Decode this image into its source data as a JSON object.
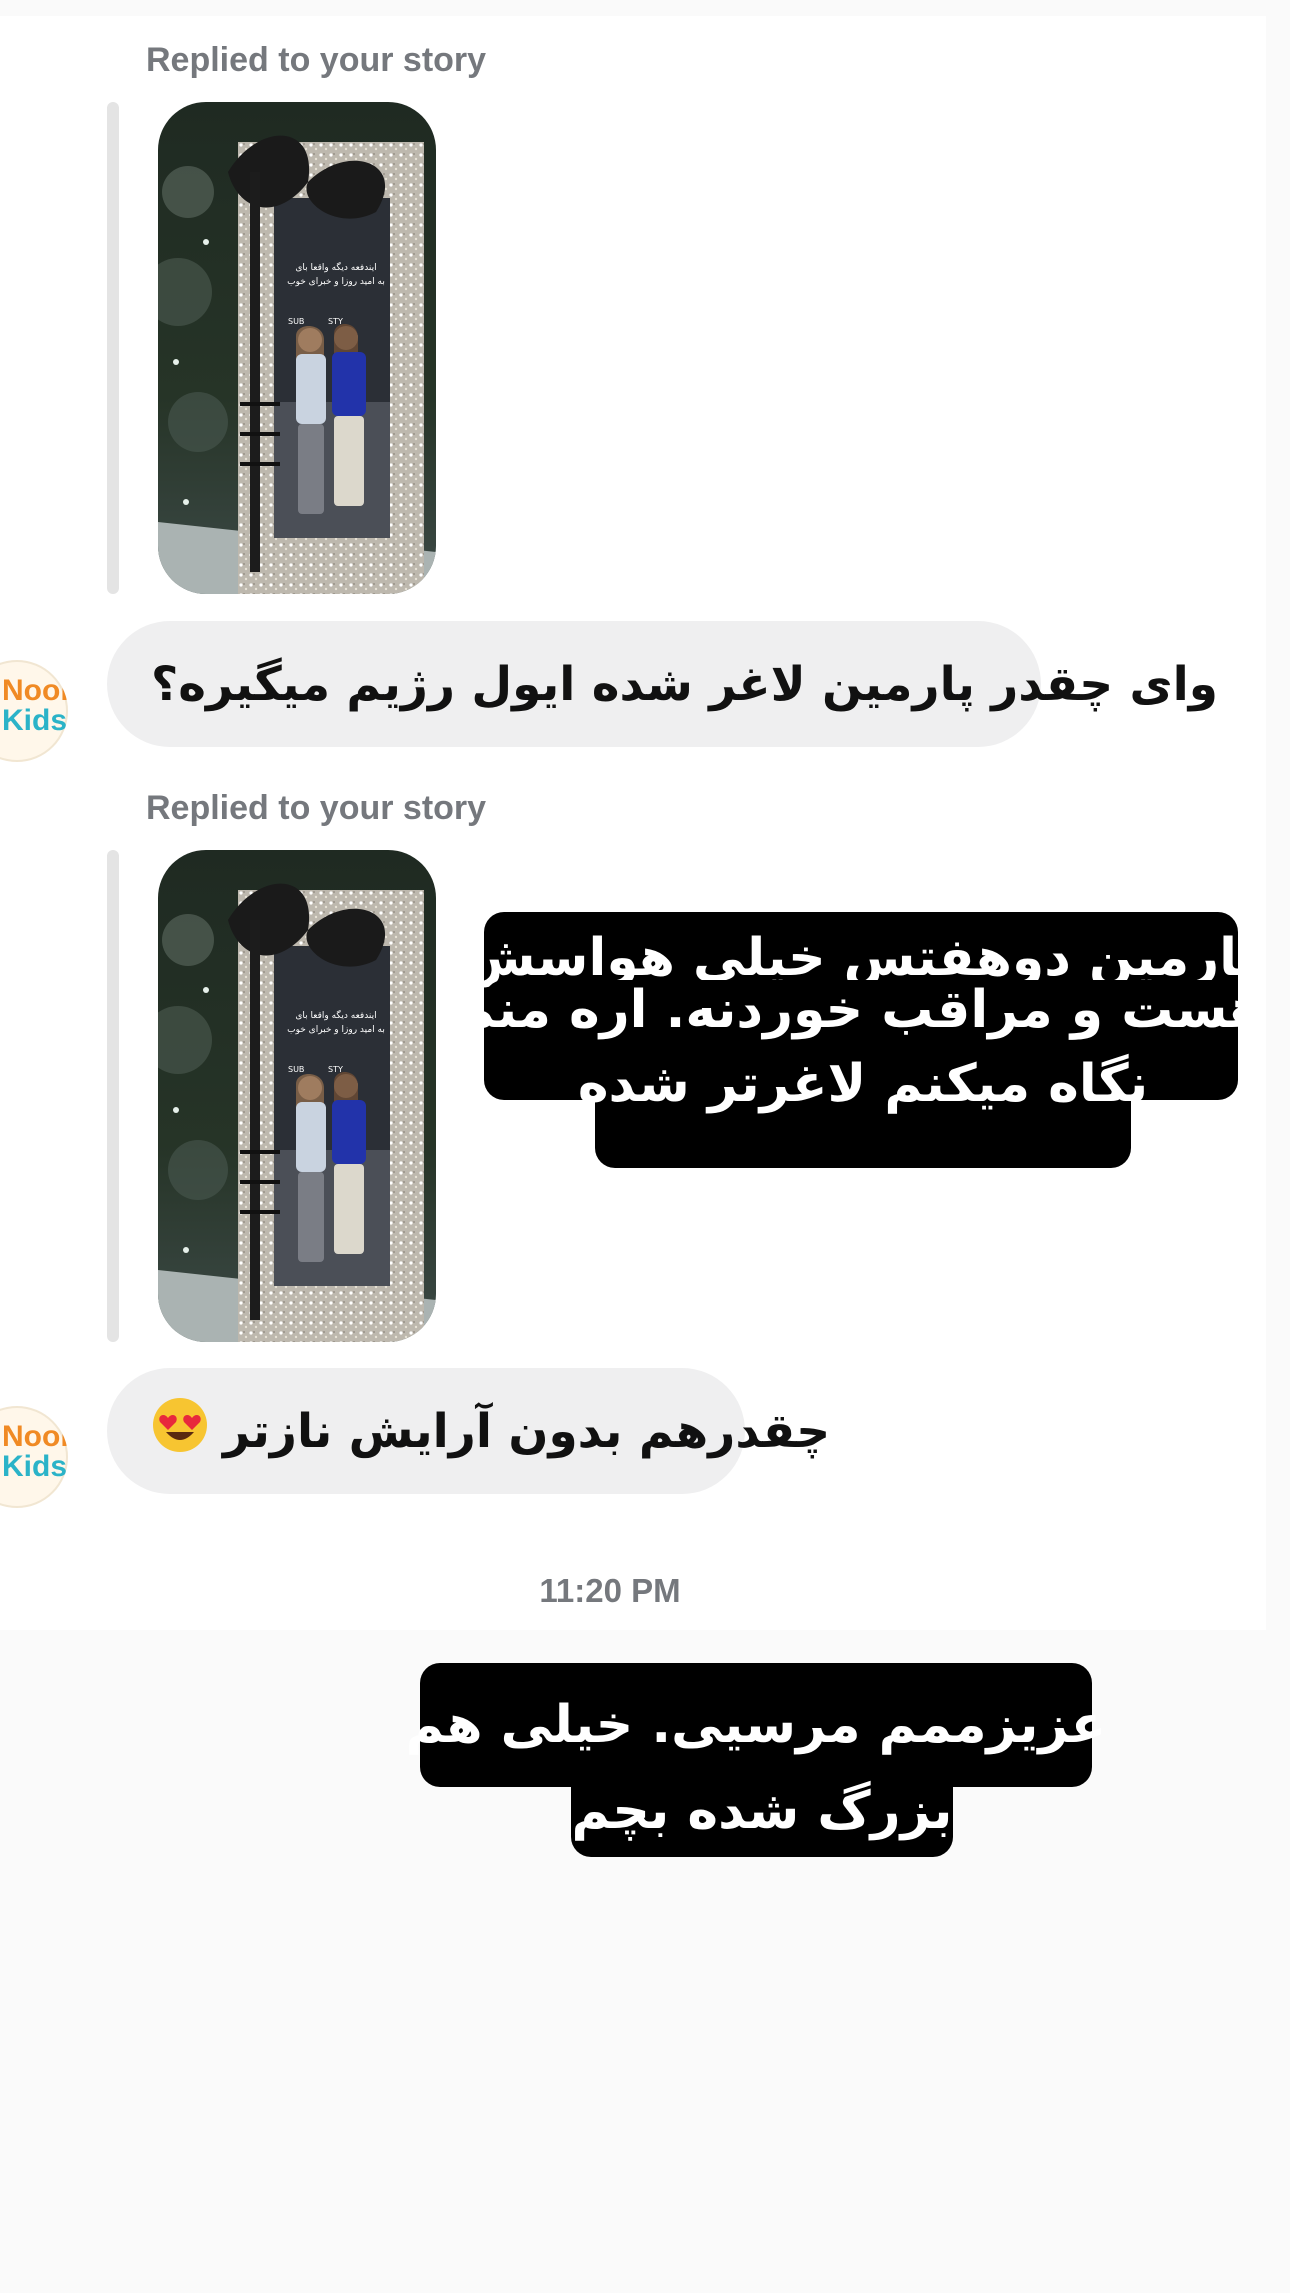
{
  "thread": {
    "replied_label_1": "Replied to your story",
    "message_1": "وای چقدر پارمین لاغر شده ایول رژیم میگیره؟",
    "replied_label_2": "Replied to your story",
    "message_2": "چقدرهم بدون آرایش نازتر",
    "message_2_emoji": "smiling-face-with-heart-eyes",
    "timestamp": "11:20 PM"
  },
  "story": {
    "caption_line_1": "ایندفعه دیگه واقعا بای",
    "caption_line_2": "به امید روزا و خبرای خوب",
    "sign_text_1": "SUB",
    "sign_text_2": "STY"
  },
  "avatar": {
    "line_1": "Noor",
    "line_2": "Kidss"
  },
  "overlay_text_1": {
    "line_1": "پارمین دوهفتس خیلی هواسش",
    "line_2": "هست و مراقب خوردنه. اره منم",
    "line_3": "نگاه میکنم لاغرتر شده"
  },
  "overlay_text_2": {
    "line_1": "عزیزممم مرسیی. خیلی هم",
    "line_2": "بزرگ شده بچم"
  },
  "colors": {
    "background": "#fafafa",
    "card": "#ffffff",
    "bubble": "#efeff0",
    "secondary_text": "#75787d",
    "overlay_box": "#000000"
  }
}
